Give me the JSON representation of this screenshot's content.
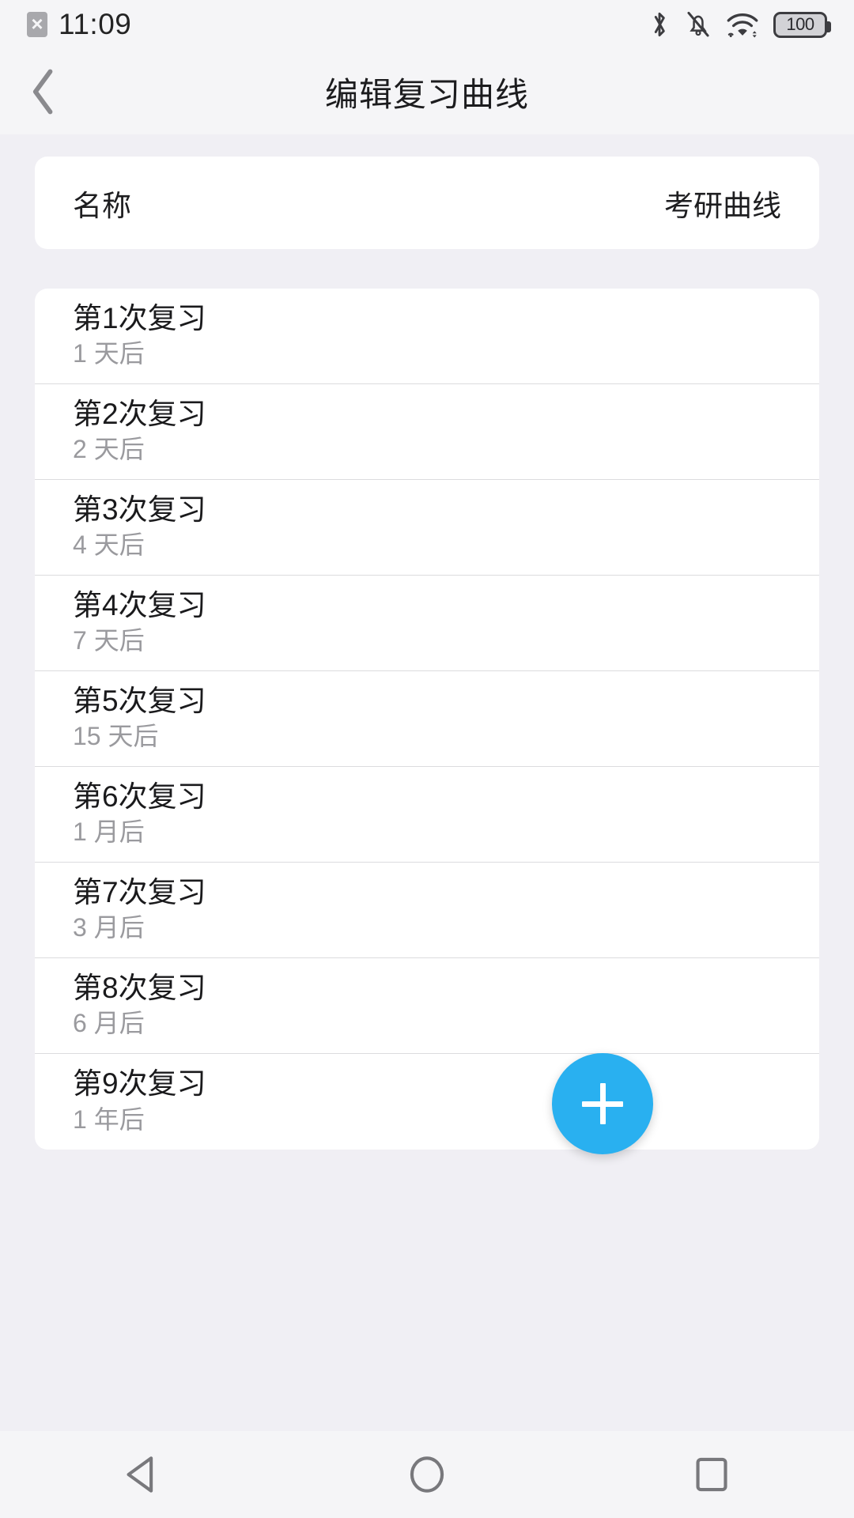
{
  "status_bar": {
    "sim_icon": "sim-card-off-icon",
    "time": "11:09",
    "bluetooth_icon": "bluetooth-icon",
    "silent_icon": "bell-muted-icon",
    "wifi_icon": "wifi-icon",
    "battery_level": "100"
  },
  "header": {
    "back_icon": "chevron-left-icon",
    "title": "编辑复习曲线"
  },
  "name_card": {
    "label": "名称",
    "value": "考研曲线"
  },
  "review_list": {
    "items": [
      {
        "title": "第1次复习",
        "interval": "1 天后"
      },
      {
        "title": "第2次复习",
        "interval": "2 天后"
      },
      {
        "title": "第3次复习",
        "interval": "4 天后"
      },
      {
        "title": "第4次复习",
        "interval": "7 天后"
      },
      {
        "title": "第5次复习",
        "interval": "15 天后"
      },
      {
        "title": "第6次复习",
        "interval": "1 月后"
      },
      {
        "title": "第7次复习",
        "interval": "3 月后"
      },
      {
        "title": "第8次复习",
        "interval": "6 月后"
      },
      {
        "title": "第9次复习",
        "interval": "1 年后"
      }
    ]
  },
  "fab": {
    "icon": "plus-icon",
    "color": "#29b0f0"
  },
  "navigation_bar": {
    "back_icon": "triangle-back-icon",
    "home_icon": "circle-home-icon",
    "recents_icon": "square-recents-icon"
  },
  "colors": {
    "page_background": "#f0eff4",
    "bar_background": "#f5f5f7",
    "card_background": "#ffffff",
    "primary_text": "#1a1a1c",
    "secondary_text": "#9a9a9e",
    "divider": "#dcdcde",
    "accent": "#29b0f0"
  }
}
